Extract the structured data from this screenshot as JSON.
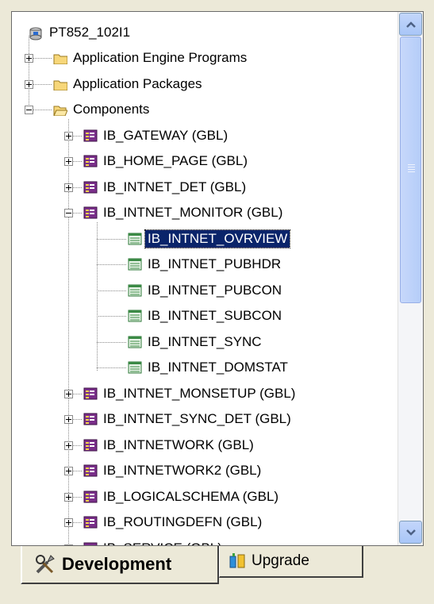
{
  "tree": {
    "root": {
      "label": "PT852_102I1",
      "icon": "database-icon"
    },
    "items": [
      {
        "name": "tree-item-application-engine-programs",
        "label": "Application Engine Programs",
        "icon": "folder-icon",
        "expander": "plus"
      },
      {
        "name": "tree-item-application-packages",
        "label": "Application Packages",
        "icon": "folder-icon",
        "expander": "plus"
      },
      {
        "name": "tree-item-components",
        "label": "Components",
        "icon": "folder-open-icon",
        "expander": "minus"
      },
      {
        "name": "tree-item-ib-gateway",
        "label": "IB_GATEWAY (GBL)",
        "icon": "component-icon",
        "expander": "plus"
      },
      {
        "name": "tree-item-ib-home-page",
        "label": "IB_HOME_PAGE (GBL)",
        "icon": "component-icon",
        "expander": "plus"
      },
      {
        "name": "tree-item-ib-intnet-det",
        "label": "IB_INTNET_DET (GBL)",
        "icon": "component-icon",
        "expander": "plus"
      },
      {
        "name": "tree-item-ib-intnet-monitor",
        "label": "IB_INTNET_MONITOR (GBL)",
        "icon": "component-icon",
        "expander": "minus"
      },
      {
        "name": "tree-item-ib-intnet-ovrview",
        "label": "IB_INTNET_OVRVIEW",
        "icon": "page-icon",
        "selected": true
      },
      {
        "name": "tree-item-ib-intnet-pubhdr",
        "label": "IB_INTNET_PUBHDR",
        "icon": "page-icon"
      },
      {
        "name": "tree-item-ib-intnet-pubcon",
        "label": "IB_INTNET_PUBCON",
        "icon": "page-icon"
      },
      {
        "name": "tree-item-ib-intnet-subcon",
        "label": "IB_INTNET_SUBCON",
        "icon": "page-icon"
      },
      {
        "name": "tree-item-ib-intnet-sync",
        "label": "IB_INTNET_SYNC",
        "icon": "page-icon"
      },
      {
        "name": "tree-item-ib-intnet-domstat",
        "label": "IB_INTNET_DOMSTAT",
        "icon": "page-icon"
      },
      {
        "name": "tree-item-ib-intnet-monsetup",
        "label": "IB_INTNET_MONSETUP (GBL)",
        "icon": "component-icon",
        "expander": "plus"
      },
      {
        "name": "tree-item-ib-intnet-sync-det",
        "label": "IB_INTNET_SYNC_DET (GBL)",
        "icon": "component-icon",
        "expander": "plus"
      },
      {
        "name": "tree-item-ib-intnetwork",
        "label": "IB_INTNETWORK (GBL)",
        "icon": "component-icon",
        "expander": "plus"
      },
      {
        "name": "tree-item-ib-intnetwork2",
        "label": "IB_INTNETWORK2 (GBL)",
        "icon": "component-icon",
        "expander": "plus"
      },
      {
        "name": "tree-item-ib-logicalschema",
        "label": "IB_LOGICALSCHEMA (GBL)",
        "icon": "component-icon",
        "expander": "plus"
      },
      {
        "name": "tree-item-ib-routingdefn",
        "label": "IB_ROUTINGDEFN (GBL)",
        "icon": "component-icon",
        "expander": "plus"
      },
      {
        "name": "tree-item-ib-service",
        "label": "IB_SERVICE (GBL)",
        "icon": "component-icon",
        "expander": "plus"
      }
    ]
  },
  "tabs": [
    {
      "label": "Development",
      "icon": "tools-icon",
      "active": true
    },
    {
      "label": "Upgrade",
      "icon": "upgrade-icon",
      "active": false
    }
  ],
  "colors": {
    "selection": "#0a246a",
    "scrollbar": "#b5cdf8",
    "window": "#ece9d8"
  }
}
